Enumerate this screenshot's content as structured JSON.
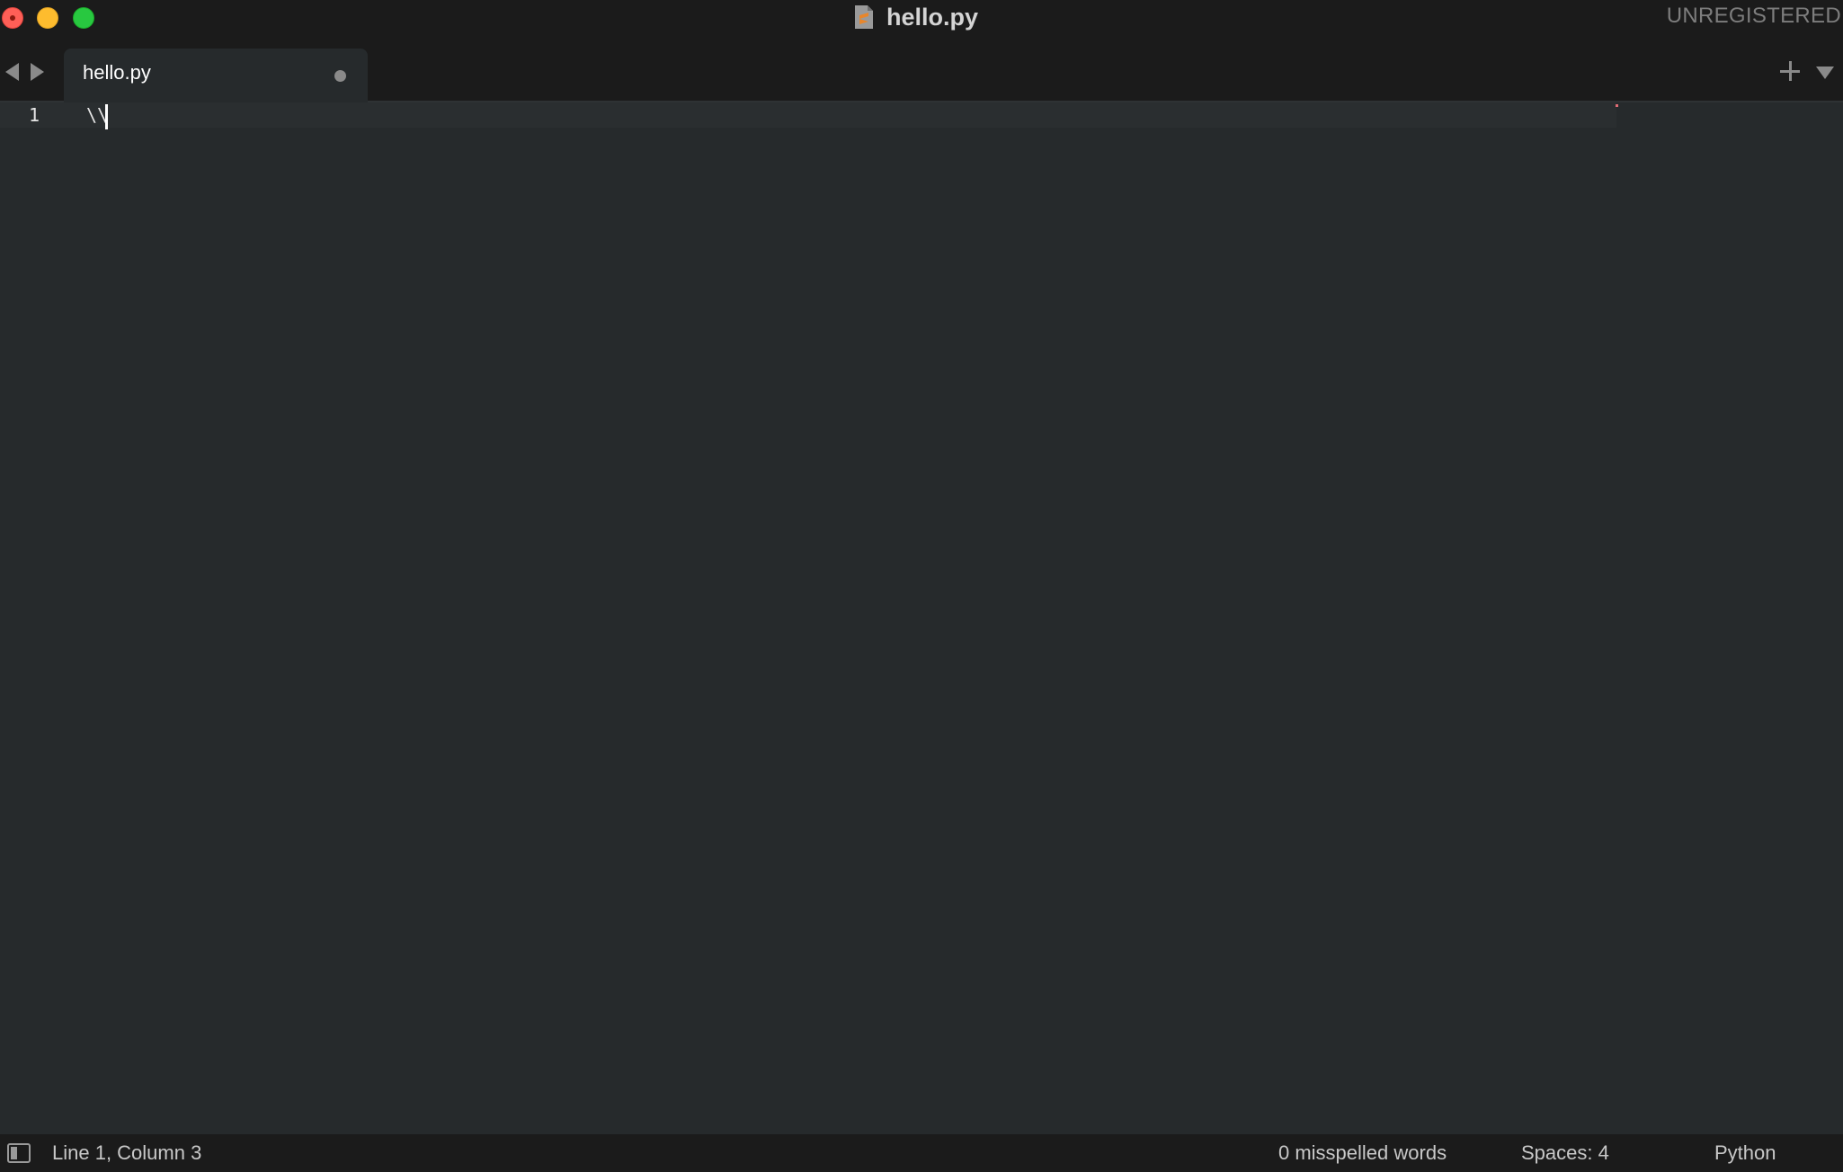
{
  "window": {
    "title": "hello.py",
    "license_status": "UNREGISTERED"
  },
  "icons": {
    "close": "close-window-icon",
    "minimize": "minimize-window-icon",
    "maximize": "maximize-window-icon",
    "file": "sublime-file-icon",
    "back": "back-arrow-icon",
    "forward": "forward-arrow-icon",
    "new_tab": "plus-icon",
    "tab_menu": "dropdown-triangle-icon",
    "sidebar": "sidebar-toggle-icon"
  },
  "tabs": [
    {
      "label": "hello.py",
      "active": true,
      "modified": true
    }
  ],
  "editor": {
    "lines": [
      {
        "number": "1",
        "text": "\\\\"
      }
    ],
    "cursor": {
      "line": 1,
      "column": 3
    }
  },
  "status_bar": {
    "position": "Line 1, Column 3",
    "spelling": "0 misspelled words",
    "indentation": "Spaces: 4",
    "syntax": "Python"
  },
  "colors": {
    "chrome": "#1b1b1b",
    "editor_bg": "#262a2c",
    "text": "#e6e6e6",
    "close": "#fe5f57",
    "minimize": "#febc2e",
    "maximize": "#28c840"
  }
}
